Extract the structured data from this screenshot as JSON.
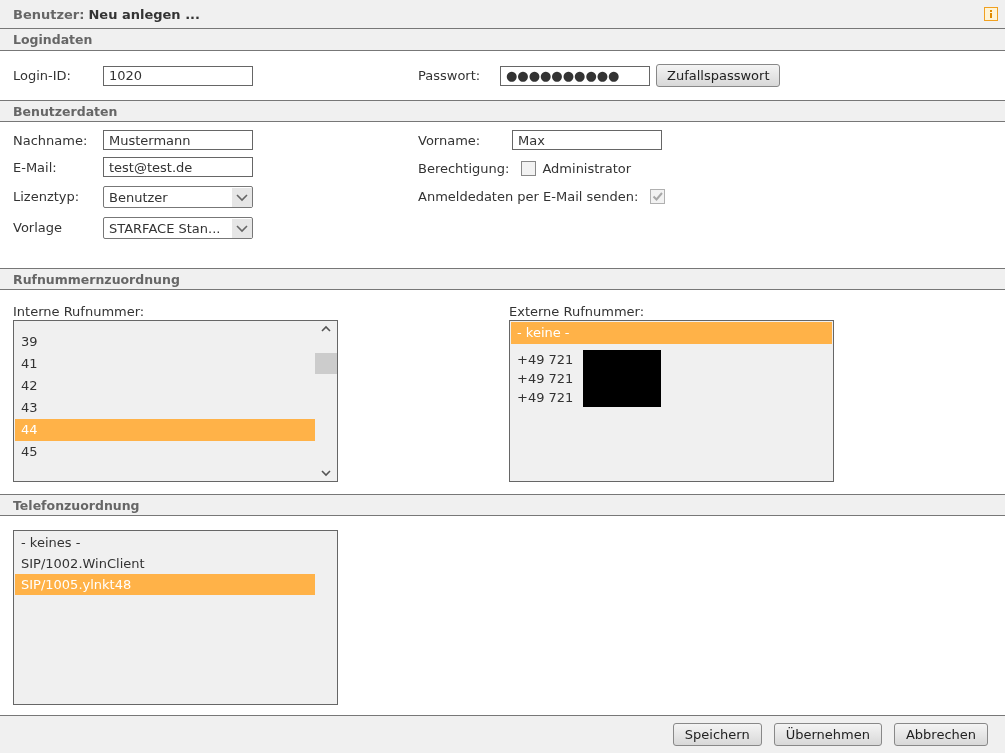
{
  "header": {
    "prefix": "Benutzer:",
    "title": "Neu anlegen ..."
  },
  "login": {
    "heading": "Logindaten",
    "id_label": "Login-ID:",
    "id_value": "1020",
    "password_label": "Passwort:",
    "password_value": "●●●●●●●●●●",
    "random_button": "Zufallspasswort"
  },
  "user": {
    "heading": "Benutzerdaten",
    "left": [
      {
        "kind": "input",
        "label": "Nachname:",
        "value": "Mustermann"
      },
      {
        "kind": "input",
        "label": "E-Mail:",
        "value": "test@test.de"
      },
      {
        "kind": "select",
        "label": "Lizenztyp:",
        "value": "Benutzer"
      },
      {
        "kind": "select",
        "label": "Vorlage",
        "value": "STARFACE Stan..."
      }
    ],
    "right": [
      {
        "kind": "input",
        "label": "Vorname:",
        "value": "Max"
      },
      {
        "kind": "checkbox",
        "label": "Berechtigung:",
        "option": "Administrator",
        "checked": false,
        "disabled": false
      },
      {
        "kind": "checkbox",
        "label": "Anmeldedaten per E-Mail senden:",
        "checked": true,
        "disabled": true
      }
    ]
  },
  "numbers": {
    "heading": "Rufnummernzuordnung",
    "internal_label": "Interne Rufnummer:",
    "internal": [
      {
        "text": "39",
        "selected": false
      },
      {
        "text": "41",
        "selected": false
      },
      {
        "text": "42",
        "selected": false
      },
      {
        "text": "43",
        "selected": false
      },
      {
        "text": "44",
        "selected": true
      },
      {
        "text": "45",
        "selected": false
      }
    ],
    "external_label": "Externe Rufnummer:",
    "external": [
      {
        "text": "- keine -",
        "selected": true,
        "redacted": false
      },
      {
        "text": "+49 721",
        "selected": false,
        "redacted": true
      },
      {
        "text": "+49 721",
        "selected": false,
        "redacted": true
      },
      {
        "text": "+49 721",
        "selected": false,
        "redacted": true
      }
    ]
  },
  "phones": {
    "heading": "Telefonzuordnung",
    "items": [
      {
        "text": "- keines -",
        "selected": false
      },
      {
        "text": "SIP/1002.WinClient",
        "selected": false
      },
      {
        "text": "SIP/1005.ylnkt48",
        "selected": true
      }
    ]
  },
  "buttons": [
    "Speichern",
    "Übernehmen",
    "Abbrechen"
  ]
}
